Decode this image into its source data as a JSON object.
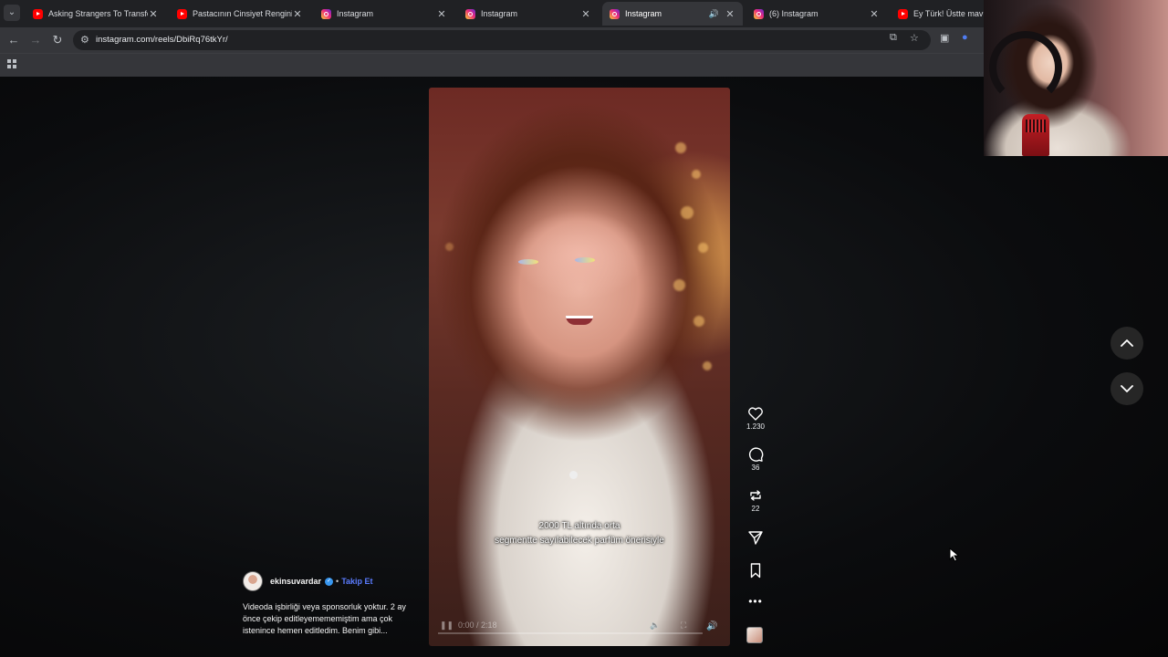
{
  "browser": {
    "tabs": [
      {
        "title": "Asking Strangers To Transform",
        "favicon": "youtube",
        "active": false
      },
      {
        "title": "Pastacının Cinsiyet Rengini Karı",
        "favicon": "youtube",
        "active": false
      },
      {
        "title": "Instagram",
        "favicon": "instagram",
        "active": false
      },
      {
        "title": "Instagram",
        "favicon": "instagram",
        "active": false
      },
      {
        "title": "Instagram",
        "favicon": "instagram",
        "active": true,
        "audio": true
      },
      {
        "title": "(6) Instagram",
        "favicon": "instagram",
        "active": false
      },
      {
        "title": "Ey Türk! Üstte mavi gök",
        "favicon": "youtube",
        "active": false
      }
    ],
    "url": "instagram.com/reels/DbiRq76tkYr/"
  },
  "reel": {
    "subtitle_line1": "2000 TL altında orta",
    "subtitle_line2": "segmentte sayılabilecek parfüm önerisiyle",
    "time": "0:00 / 2:18",
    "likes": "1.230",
    "comments": "36",
    "reposts": "22",
    "author": {
      "username": "ekinsuvardar",
      "follow_label": "Takip Et",
      "separator": "•"
    },
    "caption": "Videoda işbirliği veya sponsorluk yoktur. 2 ay önce çekip editleyemememiştim ama çok istenince hemen editledim. Benim gibi..."
  },
  "colors": {
    "follow": "#5b7cff",
    "verified": "#3897f0",
    "chrome_dark": "#202124",
    "chrome_toolbar": "#35363a"
  },
  "icons": {
    "like": "heart-icon",
    "comment": "comment-icon",
    "repost": "repost-icon",
    "share": "send-icon",
    "save": "bookmark-icon",
    "more": "more-icon",
    "prev": "chevron-up-icon",
    "next": "chevron-down-icon"
  }
}
